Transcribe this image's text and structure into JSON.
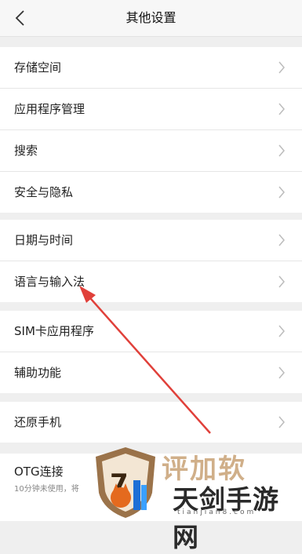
{
  "header": {
    "title": "其他设置",
    "back_icon": "chevron-left-icon"
  },
  "groups": [
    {
      "items": [
        "存储空间",
        "应用程序管理",
        "搜索",
        "安全与隐私"
      ]
    },
    {
      "items": [
        "日期与时间",
        "语言与输入法"
      ]
    },
    {
      "items": [
        "SIM卡应用程序",
        "辅助功能"
      ]
    },
    {
      "items": [
        "还原手机"
      ]
    },
    {
      "items": [
        {
          "label": "OTG连接",
          "sublabel": "10分钟未使用，将"
        }
      ]
    }
  ],
  "annotation": {
    "arrow_color": "#e0403a",
    "points_to": "语言与输入法"
  },
  "watermark": {
    "faded_text": "评加软",
    "text": "天剑手游网",
    "url": "tianjian8.com"
  }
}
